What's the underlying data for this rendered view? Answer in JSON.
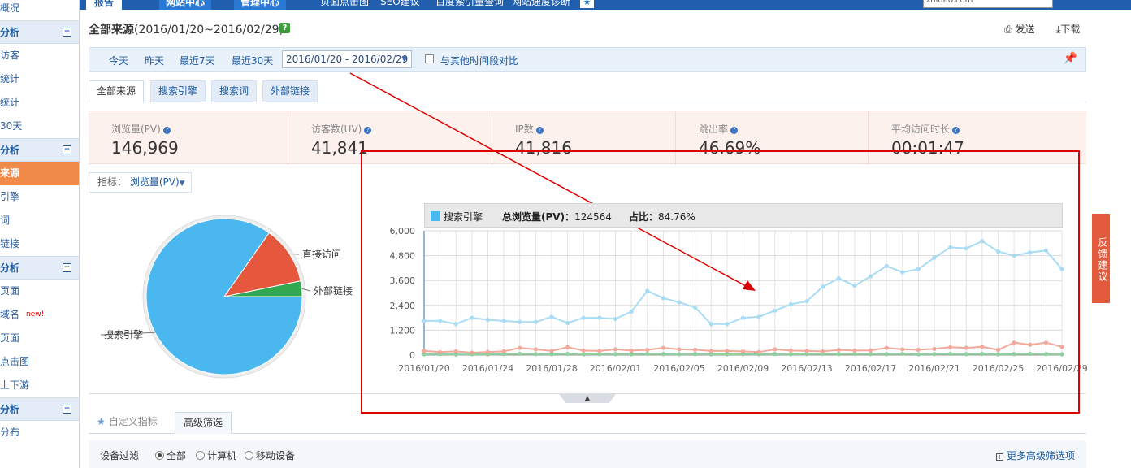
{
  "topnav": {
    "tabs": [
      "报告",
      "网站中心",
      "管理中心"
    ],
    "links": [
      "页面点击图",
      "SEO建议",
      "百度索引量查询",
      "网站速度诊断"
    ],
    "search_value": "zhidao.com"
  },
  "sidebar": {
    "rows": [
      {
        "type": "item",
        "label": "概况"
      },
      {
        "type": "section",
        "label": "分析"
      },
      {
        "type": "item",
        "label": "访客"
      },
      {
        "type": "item",
        "label": "统计"
      },
      {
        "type": "item",
        "label": "统计"
      },
      {
        "type": "item",
        "label": "30天"
      },
      {
        "type": "section",
        "label": "分析"
      },
      {
        "type": "active",
        "label": "来源"
      },
      {
        "type": "item",
        "label": "引擎"
      },
      {
        "type": "item",
        "label": "词"
      },
      {
        "type": "item",
        "label": "链接"
      },
      {
        "type": "section",
        "label": "分析"
      },
      {
        "type": "item",
        "label": "页面"
      },
      {
        "type": "item",
        "label": "域名",
        "badge": "new!"
      },
      {
        "type": "item",
        "label": "页面"
      },
      {
        "type": "item",
        "label": "点击图"
      },
      {
        "type": "item",
        "label": "上下游"
      },
      {
        "type": "section",
        "label": "分析"
      },
      {
        "type": "item",
        "label": "分布"
      }
    ]
  },
  "page": {
    "title_bold": "全部来源",
    "title_range": "(2016/01/20~2016/02/29)",
    "help": "?",
    "send": "发送",
    "download": "下载"
  },
  "datebar": {
    "quick": [
      "今天",
      "昨天",
      "最近7天",
      "最近30天"
    ],
    "range": "2016/01/20 - 2016/02/29",
    "compare": "与其他时间段对比"
  },
  "tabs": [
    "全部来源",
    "搜索引擎",
    "搜索词",
    "外部链接"
  ],
  "kpis": [
    {
      "label": "浏览量(PV)",
      "value": "146,969"
    },
    {
      "label": "访客数(UV)",
      "value": "41,841"
    },
    {
      "label": "IP数",
      "value": "41,816"
    },
    {
      "label": "跳出率",
      "value": "46.69%"
    },
    {
      "label": "平均访问时长",
      "value": "00:01:47"
    }
  ],
  "metric": {
    "prefix": "指标：",
    "value": "浏览量(PV)"
  },
  "tooltip": {
    "series": "搜索引擎",
    "total_label": "总浏览量(PV)：",
    "total_value": "124564",
    "share_label": "占比：",
    "share_value": "84.76%"
  },
  "chart_data": [
    {
      "type": "pie",
      "labels": [
        "搜索引擎",
        "直接访问",
        "外部链接"
      ],
      "values": [
        84.76,
        12.0,
        3.24
      ],
      "colors": [
        "#4ab7ef",
        "#e5583e",
        "#2fa84f"
      ]
    },
    {
      "type": "line",
      "x": [
        "2016/01/20",
        "2016/01/21",
        "2016/01/22",
        "2016/01/23",
        "2016/01/24",
        "2016/01/25",
        "2016/01/26",
        "2016/01/27",
        "2016/01/28",
        "2016/01/29",
        "2016/01/30",
        "2016/01/31",
        "2016/02/01",
        "2016/02/02",
        "2016/02/03",
        "2016/02/04",
        "2016/02/05",
        "2016/02/06",
        "2016/02/07",
        "2016/02/08",
        "2016/02/09",
        "2016/02/10",
        "2016/02/11",
        "2016/02/12",
        "2016/02/13",
        "2016/02/14",
        "2016/02/15",
        "2016/02/16",
        "2016/02/17",
        "2016/02/18",
        "2016/02/19",
        "2016/02/20",
        "2016/02/21",
        "2016/02/22",
        "2016/02/23",
        "2016/02/24",
        "2016/02/25",
        "2016/02/26",
        "2016/02/27",
        "2016/02/28",
        "2016/02/29"
      ],
      "xticks": [
        "2016/01/20",
        "2016/01/24",
        "2016/01/28",
        "2016/02/01",
        "2016/02/05",
        "2016/02/09",
        "2016/02/13",
        "2016/02/17",
        "2016/02/21",
        "2016/02/25",
        "2016/02/29"
      ],
      "yticks": [
        "6,000",
        "4,800",
        "3,600",
        "2,400",
        "1,200",
        "0"
      ],
      "ylim": [
        0,
        6000
      ],
      "series": [
        {
          "color": "#a8dcf4",
          "values": [
            1650,
            1650,
            1500,
            1800,
            1700,
            1650,
            1600,
            1600,
            1850,
            1550,
            1800,
            1800,
            1750,
            2100,
            3100,
            2750,
            2550,
            2300,
            1500,
            1500,
            1800,
            1850,
            2150,
            2450,
            2600,
            3300,
            3700,
            3350,
            3800,
            4300,
            4000,
            4150,
            4700,
            5200,
            5150,
            5500,
            5000,
            4800,
            4950,
            5050,
            4150
          ]
        },
        {
          "color": "#f2a99a",
          "values": [
            200,
            150,
            180,
            120,
            150,
            180,
            350,
            280,
            200,
            380,
            220,
            200,
            280,
            220,
            250,
            350,
            280,
            260,
            200,
            200,
            180,
            150,
            280,
            220,
            200,
            180,
            250,
            220,
            230,
            350,
            280,
            260,
            300,
            380,
            350,
            400,
            250,
            600,
            500,
            600,
            400
          ]
        },
        {
          "color": "#8ed19f",
          "values": [
            40,
            50,
            30,
            40,
            40,
            50,
            60,
            50,
            40,
            60,
            40,
            50,
            50,
            40,
            60,
            50,
            40,
            50,
            40,
            40,
            50,
            40,
            50,
            40,
            50,
            60,
            50,
            60,
            50,
            50,
            60,
            40,
            50,
            60,
            50,
            60,
            40,
            50,
            60,
            50,
            40
          ]
        }
      ]
    }
  ],
  "bottom_tabs": [
    "自定义指标",
    "高级筛选"
  ],
  "filter": {
    "label": "设备过滤",
    "options": [
      "全部",
      "计算机",
      "移动设备"
    ],
    "more": "更多高级筛选项"
  },
  "feedback": "反馈建议",
  "colors": {
    "brand": "#1f5fae",
    "accent": "#f08a4b",
    "annotation": "#dd0000"
  }
}
